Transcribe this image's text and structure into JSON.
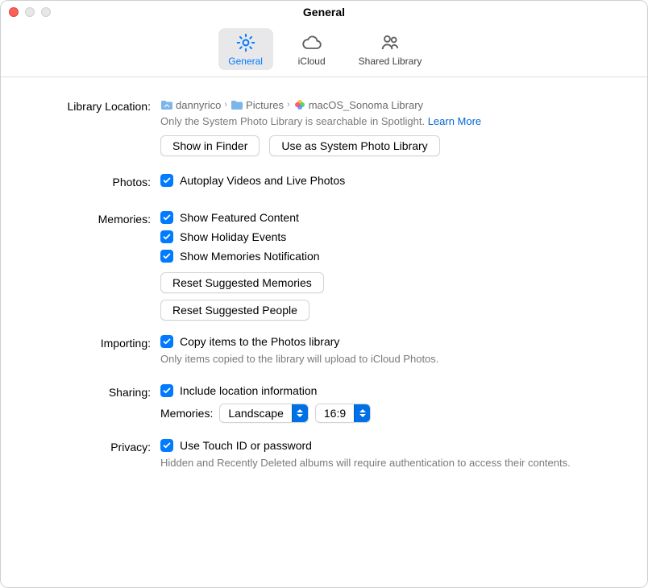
{
  "window_title": "General",
  "tabs": {
    "general": "General",
    "icloud": "iCloud",
    "shared_library": "Shared Library"
  },
  "library_location": {
    "label": "Library Location:",
    "path_segments": [
      "dannyrico",
      "Pictures",
      "macOS_Sonoma Library"
    ],
    "description": "Only the System Photo Library is searchable in Spotlight.",
    "learn_more": "Learn More",
    "show_in_finder": "Show in Finder",
    "use_as_system": "Use as System Photo Library"
  },
  "photos": {
    "label": "Photos:",
    "autoplay": "Autoplay Videos and Live Photos"
  },
  "memories": {
    "label": "Memories:",
    "featured": "Show Featured Content",
    "holiday": "Show Holiday Events",
    "notification": "Show Memories Notification",
    "reset_memories": "Reset Suggested Memories",
    "reset_people": "Reset Suggested People"
  },
  "importing": {
    "label": "Importing:",
    "copy_items": "Copy items to the Photos library",
    "note": "Only items copied to the library will upload to iCloud Photos."
  },
  "sharing": {
    "label": "Sharing:",
    "include_location": "Include location information",
    "memories_label": "Memories:",
    "orientation_value": "Landscape",
    "aspect_value": "16:9"
  },
  "privacy": {
    "label": "Privacy:",
    "touch_id": "Use Touch ID or password",
    "note": "Hidden and Recently Deleted albums will require authentication to access their contents."
  }
}
